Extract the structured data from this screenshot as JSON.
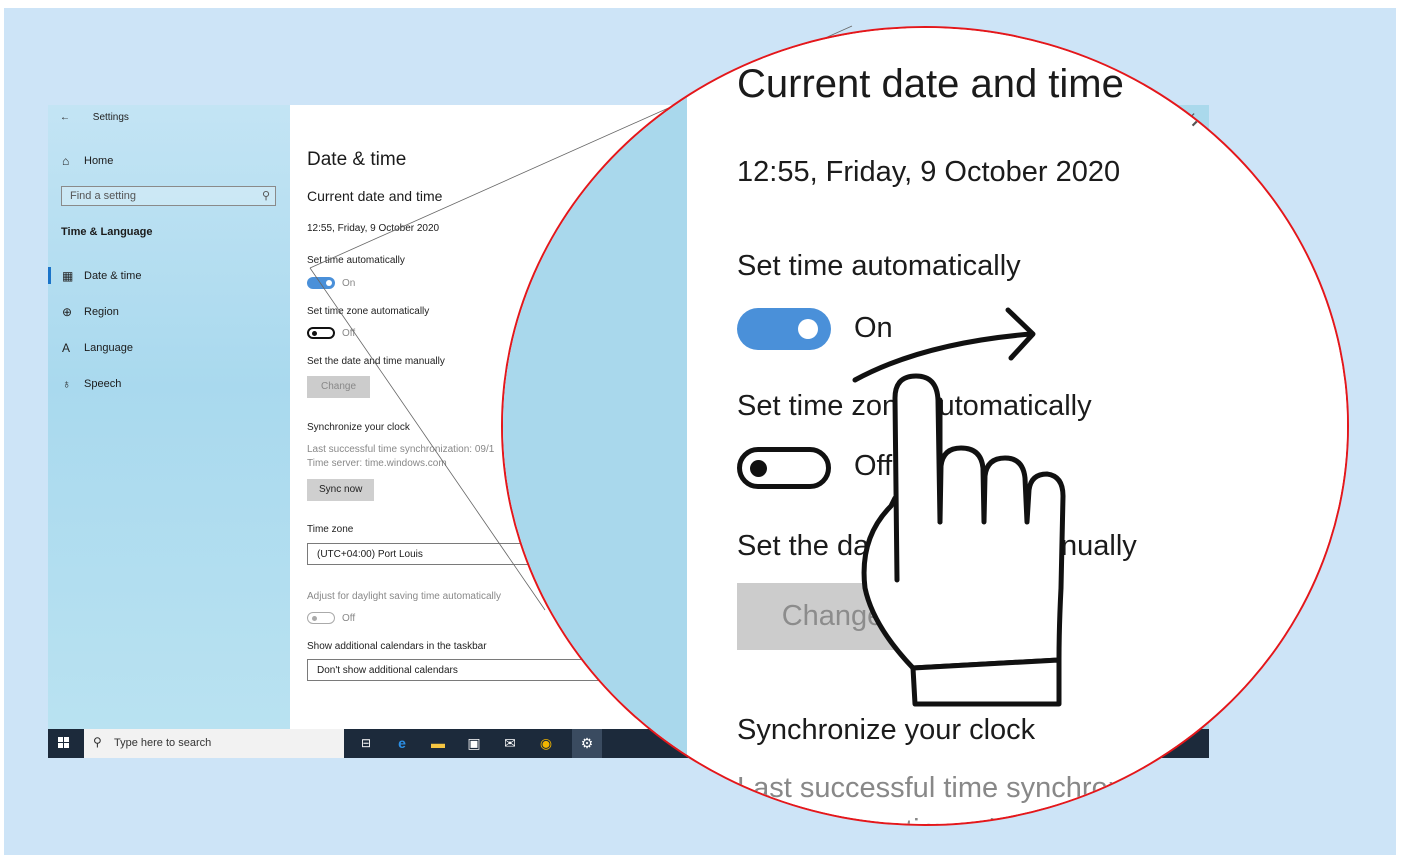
{
  "window": {
    "app_title": "Settings",
    "back_icon": "back-arrow-icon",
    "close_glyph": "✕"
  },
  "sidebar": {
    "home_label": "Home",
    "search_placeholder": "Find a setting",
    "section_title": "Time & Language",
    "items": [
      {
        "label": "Date & time",
        "icon": "calendar-clock-icon",
        "selected": true
      },
      {
        "label": "Region",
        "icon": "globe-icon",
        "selected": false
      },
      {
        "label": "Language",
        "icon": "language-icon",
        "selected": false
      },
      {
        "label": "Speech",
        "icon": "microphone-icon",
        "selected": false
      }
    ]
  },
  "content": {
    "page_title": "Date & time",
    "current_heading": "Current date and time",
    "current_datetime": "12:55, Friday, 9 October 2020",
    "set_time_auto_label": "Set time automatically",
    "set_time_auto_state": "On",
    "set_tz_auto_label": "Set time zone automatically",
    "set_tz_auto_state": "Off",
    "manual_label": "Set the date and time manually",
    "change_button": "Change",
    "sync_heading": "Synchronize your clock",
    "last_sync": "Last successful time synchronization: 09/1",
    "time_server": "Time server: time.windows.com",
    "sync_button": "Sync now",
    "timezone_label": "Time zone",
    "timezone_value": "(UTC+04:00) Port Louis",
    "dst_label": "Adjust for daylight saving time automatically",
    "dst_state": "Off",
    "calendars_label": "Show additional calendars in the taskbar",
    "calendars_value": "Don't show additional calendars"
  },
  "taskbar": {
    "search_placeholder": "Type here to search",
    "icons": [
      "task-view-icon",
      "edge-icon",
      "file-explorer-icon",
      "store-icon",
      "mail-icon",
      "chrome-icon",
      "settings-icon"
    ]
  },
  "magnifier": {
    "heading": "Current date and time",
    "datetime": "12:55, Friday, 9 October 2020",
    "set_time_auto_label": "Set time automatically",
    "set_time_auto_state": "On",
    "set_tz_auto_label": "Set time zone automatically",
    "set_tz_auto_state": "Off",
    "manual_label": "Set the date and time manually",
    "change_button": "Change",
    "sync_heading": "Synchronize your clock",
    "last_sync_partial": "Last successful time synchroni",
    "time_server_partial": "Time server: time wind",
    "ring_color": "#e4171b",
    "pointer_icon": "hand-pointer-icon",
    "swipe_arrow": "swipe-right-arrow-icon"
  },
  "colors": {
    "toggle_on": "#4a90d9",
    "taskbar": "#1c2a3b",
    "sidebar": "#aad9ec",
    "selection_bar": "#1a73c9"
  }
}
